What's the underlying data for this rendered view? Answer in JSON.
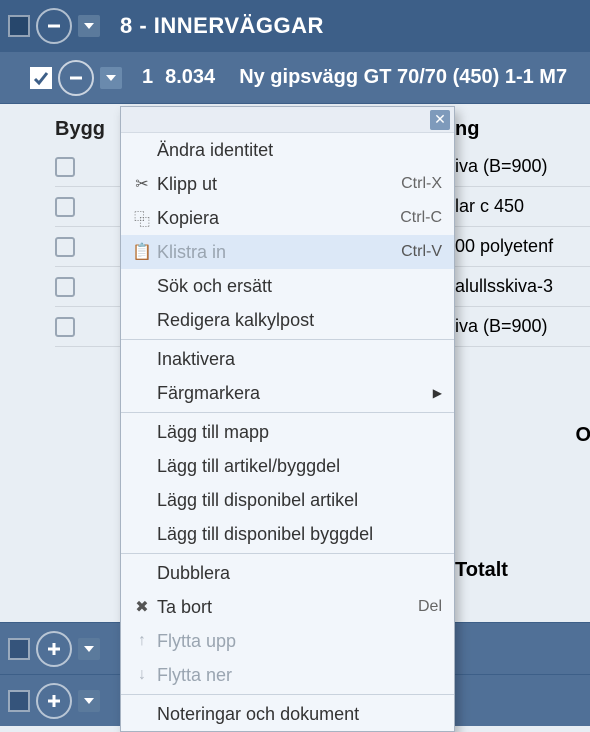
{
  "header": {
    "title": "8 - INNERVÄGGAR"
  },
  "subheader": {
    "num": "1",
    "code": "8.034",
    "desc": "Ny gipsvägg GT 70/70 (450) 1-1 M7"
  },
  "leftColHeader": "Bygg",
  "rightColHeader": "ng",
  "rows": [
    {
      "label": "",
      "right": "iva (B=900)"
    },
    {
      "label": "",
      "right": "lar c 450"
    },
    {
      "label": "",
      "right": "00 polyetenf"
    },
    {
      "label": "",
      "right": "alullsskiva-3"
    },
    {
      "label": "",
      "right": "iva (B=900)"
    }
  ],
  "totals": {
    "o": "O",
    "t": "Totalt"
  },
  "ctx": {
    "items": [
      {
        "icon": "",
        "label": "Ändra identitet",
        "shortcut": "",
        "disabled": false
      },
      {
        "icon": "✂",
        "label": "Klipp ut",
        "shortcut": "Ctrl-X",
        "disabled": false
      },
      {
        "icon": "⿻",
        "label": "Kopiera",
        "shortcut": "Ctrl-C",
        "disabled": false
      },
      {
        "icon": "📋",
        "label": "Klistra in",
        "shortcut": "Ctrl-V",
        "disabled": true,
        "hover": true
      },
      {
        "icon": "",
        "label": "Sök och ersätt",
        "shortcut": "",
        "disabled": false
      },
      {
        "icon": "",
        "label": "Redigera kalkylpost",
        "shortcut": "",
        "disabled": false
      }
    ],
    "items2": [
      {
        "icon": "",
        "label": "Inaktivera",
        "shortcut": "",
        "disabled": false
      },
      {
        "icon": "",
        "label": "Färgmarkera",
        "shortcut": "",
        "disabled": false,
        "submenu": true
      }
    ],
    "items3": [
      {
        "icon": "",
        "label": "Lägg till mapp",
        "shortcut": "",
        "disabled": false
      },
      {
        "icon": "",
        "label": "Lägg till artikel/byggdel",
        "shortcut": "",
        "disabled": false
      },
      {
        "icon": "",
        "label": "Lägg till disponibel artikel",
        "shortcut": "",
        "disabled": false
      },
      {
        "icon": "",
        "label": "Lägg till disponibel byggdel",
        "shortcut": "",
        "disabled": false
      }
    ],
    "items4": [
      {
        "icon": "",
        "label": "Dubblera",
        "shortcut": "",
        "disabled": false
      },
      {
        "icon": "✖",
        "label": "Ta bort",
        "shortcut": "Del",
        "disabled": false
      },
      {
        "icon": "↑",
        "label": "Flytta upp",
        "shortcut": "",
        "disabled": true
      },
      {
        "icon": "↓",
        "label": "Flytta ner",
        "shortcut": "",
        "disabled": true
      }
    ],
    "items5": [
      {
        "icon": "",
        "label": "Noteringar och dokument",
        "shortcut": "",
        "disabled": false
      }
    ]
  }
}
